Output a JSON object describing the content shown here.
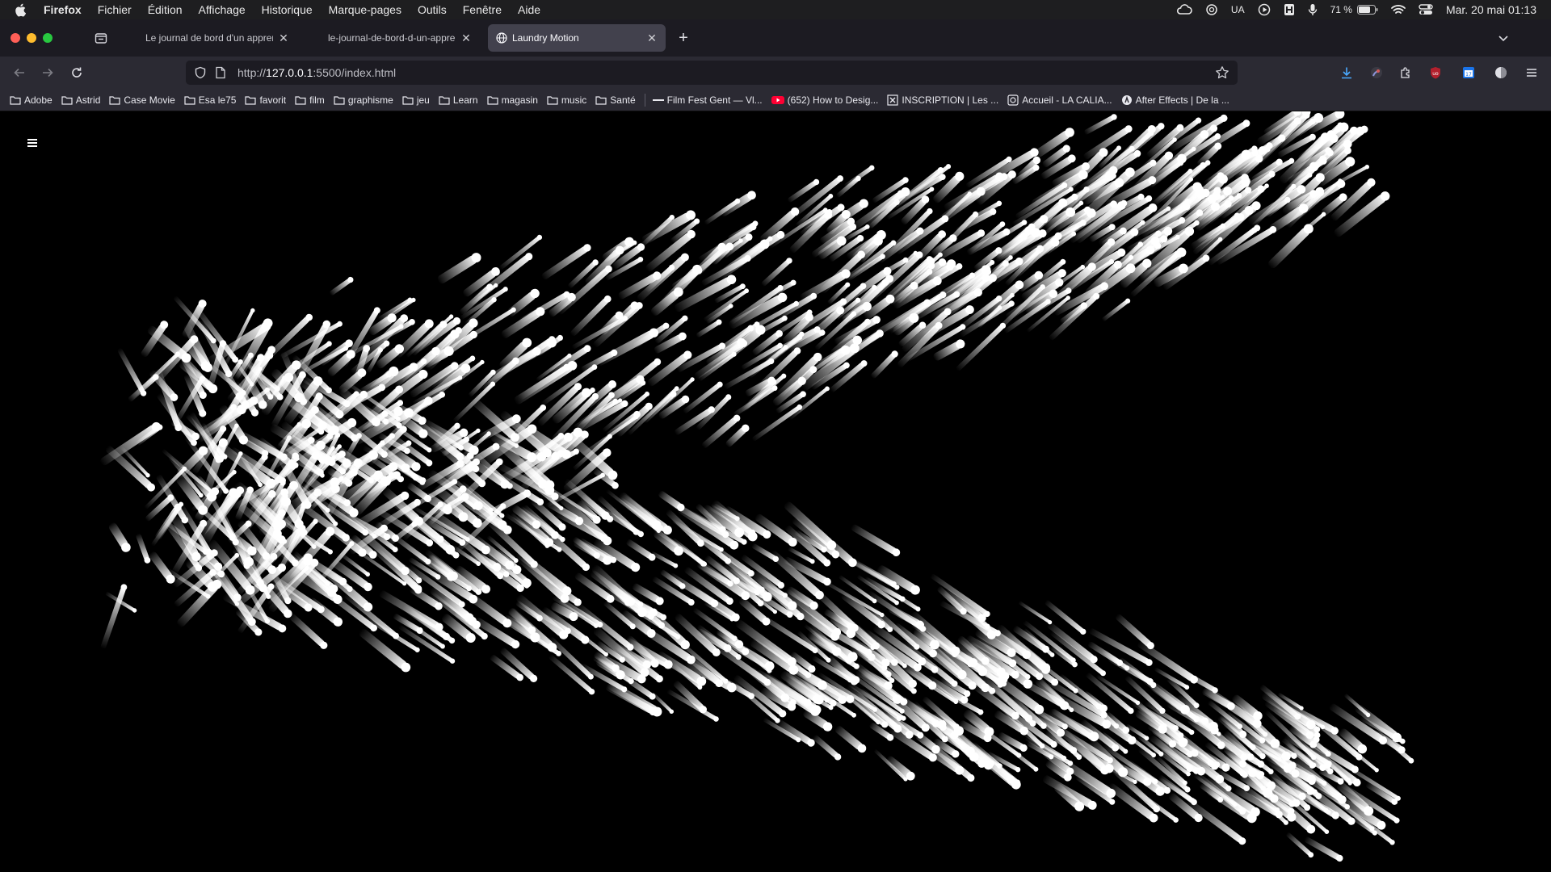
{
  "menubar": {
    "app_name": "Firefox",
    "items": [
      "Fichier",
      "Édition",
      "Affichage",
      "Historique",
      "Marque-pages",
      "Outils",
      "Fenêtre",
      "Aide"
    ],
    "status": {
      "input_source": "UA",
      "battery": "71 %",
      "clock": "Mar. 20 mai  01:13"
    }
  },
  "tabs": [
    {
      "label": "Le journal de bord d'un apprenti",
      "active": false
    },
    {
      "label": "le-journal-de-bord-d-un-apprenti",
      "active": false
    },
    {
      "label": "Laundry Motion",
      "active": true
    }
  ],
  "urlbar": {
    "url_prefix": "http://",
    "url_host": "127.0.0.1",
    "url_rest": ":5500/index.html"
  },
  "bookmarks": [
    {
      "label": "Adobe",
      "type": "folder"
    },
    {
      "label": "Astrid",
      "type": "folder"
    },
    {
      "label": "Case Movie",
      "type": "folder"
    },
    {
      "label": "Esa le75",
      "type": "folder"
    },
    {
      "label": "favorit",
      "type": "folder"
    },
    {
      "label": "film",
      "type": "folder"
    },
    {
      "label": "graphisme",
      "type": "folder"
    },
    {
      "label": "jeu",
      "type": "folder"
    },
    {
      "label": "Learn",
      "type": "folder"
    },
    {
      "label": "magasin",
      "type": "folder"
    },
    {
      "label": "music",
      "type": "folder"
    },
    {
      "label": "Santé",
      "type": "folder"
    },
    {
      "label": "Film Fest Gent — Vl...",
      "type": "site"
    },
    {
      "label": "(652) How to Desig...",
      "type": "youtube"
    },
    {
      "label": "INSCRIPTION | Les ...",
      "type": "site"
    },
    {
      "label": "Accueil - LA CALIA...",
      "type": "site"
    },
    {
      "label": "After Effects | De la ...",
      "type": "site"
    }
  ],
  "colors": {
    "menubar_bg": "#1e1e20",
    "tabstrip_bg": "#1c1b22",
    "toolbar_bg": "#2b2a33",
    "active_tab_bg": "#42414d",
    "page_bg": "#000000",
    "streak_color": "#ffffff"
  },
  "page": {
    "menu_icon": "hamburger-icon"
  }
}
